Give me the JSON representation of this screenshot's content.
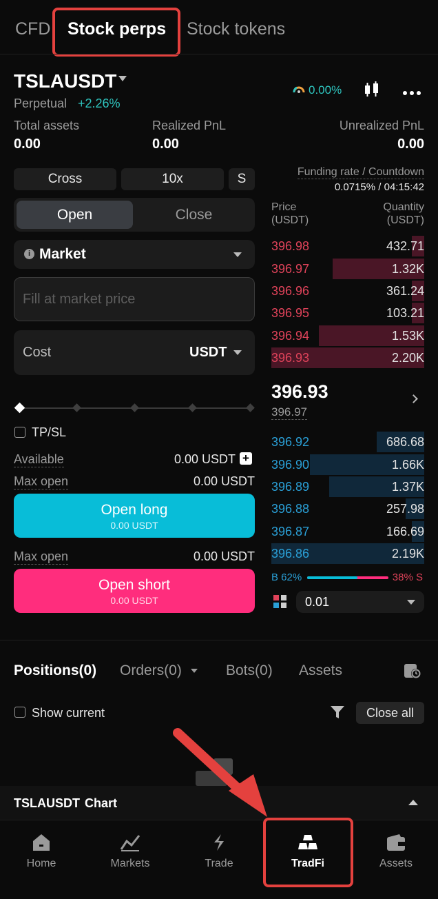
{
  "top_tabs": [
    "CFD",
    "Stock perps",
    "Stock tokens"
  ],
  "symbol": {
    "name": "TSLAUSDT",
    "type": "Perpetual",
    "change": "+2.26%",
    "indicator": "0.00%"
  },
  "stats": {
    "total_assets_label": "Total assets",
    "total_assets": "0.00",
    "realized_label": "Realized PnL",
    "realized": "0.00",
    "unrealized_label": "Unrealized PnL",
    "unrealized": "0.00"
  },
  "margin": {
    "mode": "Cross",
    "leverage": "10x",
    "s": "S"
  },
  "open_close": {
    "open": "Open",
    "close": "Close"
  },
  "order_type": "Market",
  "price_placeholder": "Fill at market price",
  "cost": {
    "label": "Cost",
    "unit": "USDT"
  },
  "tpsl_label": "TP/SL",
  "available": {
    "label": "Available",
    "value": "0.00 USDT"
  },
  "max_open_long": {
    "label": "Max open",
    "value": "0.00 USDT"
  },
  "open_long": {
    "label": "Open long",
    "sub": "0.00 USDT"
  },
  "max_open_short": {
    "label": "Max open",
    "value": "0.00 USDT"
  },
  "open_short": {
    "label": "Open short",
    "sub": "0.00 USDT"
  },
  "funding": {
    "label": "Funding rate / Countdown",
    "value": "0.0715% / 04:15:42"
  },
  "orderbook": {
    "price_header": "Price",
    "price_unit": "(USDT)",
    "qty_header": "Quantity",
    "qty_unit": "(USDT)",
    "asks": [
      {
        "price": "396.98",
        "qty": "432.71",
        "depth": 0.08
      },
      {
        "price": "396.97",
        "qty": "1.32K",
        "depth": 0.6
      },
      {
        "price": "396.96",
        "qty": "361.24",
        "depth": 0.08
      },
      {
        "price": "396.95",
        "qty": "103.21",
        "depth": 0.08
      },
      {
        "price": "396.94",
        "qty": "1.53K",
        "depth": 0.69
      },
      {
        "price": "396.93",
        "qty": "2.20K",
        "depth": 1.0
      }
    ],
    "last_price": "396.93",
    "mark_price": "396.97",
    "bids": [
      {
        "price": "396.92",
        "qty": "686.68",
        "depth": 0.31
      },
      {
        "price": "396.90",
        "qty": "1.66K",
        "depth": 0.75
      },
      {
        "price": "396.89",
        "qty": "1.37K",
        "depth": 0.62
      },
      {
        "price": "396.88",
        "qty": "257.98",
        "depth": 0.12
      },
      {
        "price": "396.87",
        "qty": "166.69",
        "depth": 0.08
      },
      {
        "price": "396.86",
        "qty": "2.19K",
        "depth": 1.0
      }
    ],
    "buy_label": "B 62%",
    "sell_label": "38% S",
    "buy_ratio": 0.62,
    "precision": "0.01"
  },
  "bottom_tabs": {
    "positions": "Positions(0)",
    "orders": "Orders(0)",
    "bots": "Bots(0)",
    "assets": "Assets"
  },
  "show_current": "Show current",
  "close_all": "Close all",
  "chart_bar": {
    "symbol": "TSLAUSDT",
    "label": "Chart"
  },
  "nav": [
    "Home",
    "Markets",
    "Trade",
    "TradFi",
    "Assets"
  ],
  "colors": {
    "accent_long": "#08bdd8",
    "accent_short": "#ff2d7d",
    "highlight": "#e4413e"
  }
}
